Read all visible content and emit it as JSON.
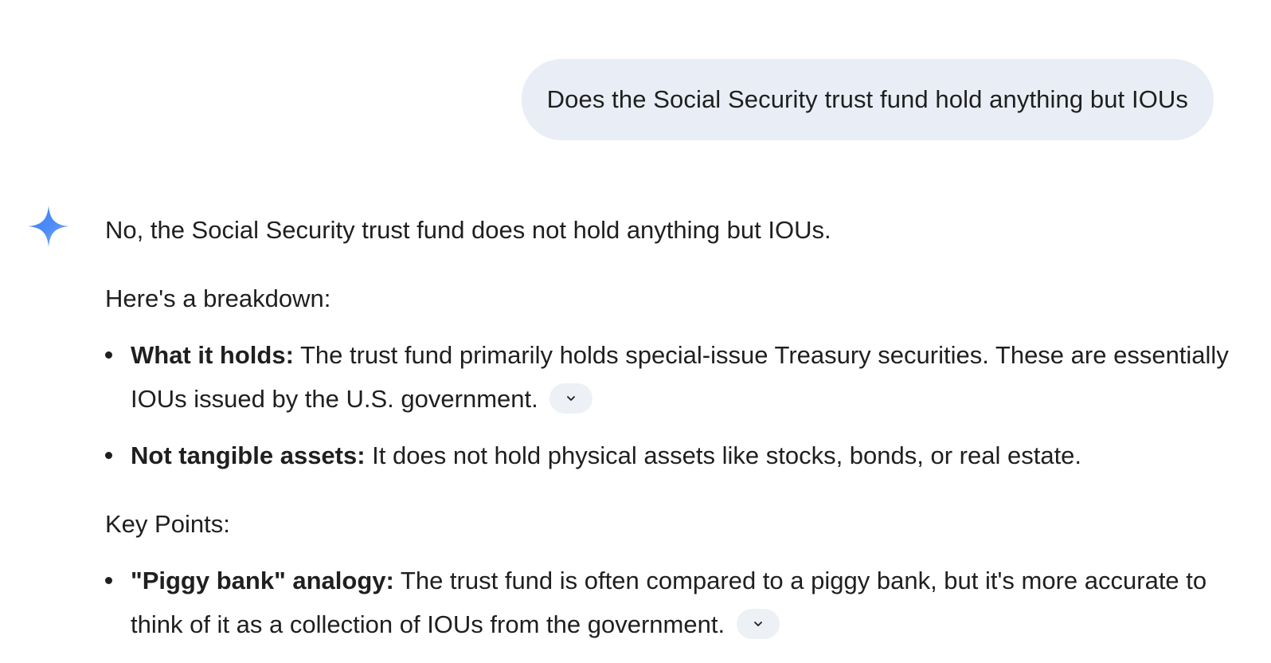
{
  "conversation": {
    "user_message": "Does the Social Security trust fund hold anything but IOUs",
    "response": {
      "intro": "No, the Social Security trust fund does not hold anything but IOUs.",
      "breakdown_lead": "Here's a breakdown:",
      "breakdown_items": [
        {
          "term": "What it holds:",
          "text": " The trust fund primarily holds special-issue Treasury securities. These are essentially IOUs issued by the U.S. government.",
          "has_source_chip": true
        },
        {
          "term": "Not tangible assets:",
          "text": " It does not hold physical assets like stocks, bonds, or real estate.",
          "has_source_chip": false
        }
      ],
      "key_points_heading": "Key Points:",
      "key_points_items": [
        {
          "term": "\"Piggy bank\" analogy:",
          "text": " The trust fund is often compared to a piggy bank, but it's more accurate to think of it as a collection of IOUs from the government.",
          "has_source_chip": true
        }
      ]
    }
  },
  "icons": {
    "assistant": "sparkle-icon",
    "source_chip": "chevron-down-icon"
  },
  "colors": {
    "user_bubble_bg": "#e9eef6",
    "text": "#1f1f1f",
    "sparkle_gradient_start": "#4a86f7",
    "sparkle_gradient_end": "#7aa4f8"
  }
}
